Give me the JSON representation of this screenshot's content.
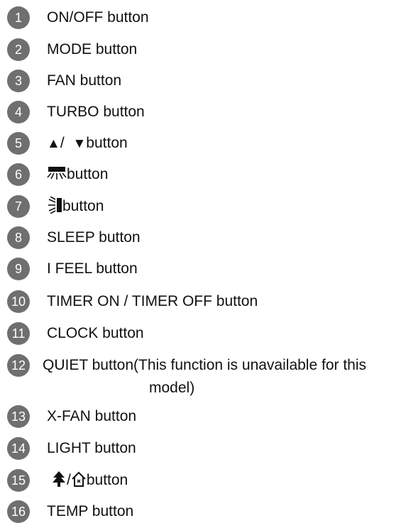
{
  "items": [
    {
      "num": "1",
      "label": "ON/OFF button"
    },
    {
      "num": "2",
      "label": "MODE button"
    },
    {
      "num": "3",
      "label": "FAN button"
    },
    {
      "num": "4",
      "label": "TURBO button"
    },
    {
      "num": "5",
      "up_glyph": "▲",
      "sep": "/ ",
      "down_glyph": "▼",
      "label": "button"
    },
    {
      "num": "6",
      "icon": "swing-up-down-icon",
      "label": "button"
    },
    {
      "num": "7",
      "icon": "swing-left-right-icon",
      "label": "button"
    },
    {
      "num": "8",
      "label": "SLEEP button"
    },
    {
      "num": "9",
      "label": "I FEEL button"
    },
    {
      "num": "10",
      "label": "TIMER ON / TIMER OFF button"
    },
    {
      "num": "11",
      "label": "CLOCK button"
    },
    {
      "num": "12",
      "label": "QUIET button(This function is unavailable for this",
      "label_cont": "model)"
    },
    {
      "num": "13",
      "label": "X-FAN button"
    },
    {
      "num": "14",
      "label": "LIGHT button"
    },
    {
      "num": "15",
      "icon_a": "tree-icon",
      "sep": "/",
      "icon_b": "home-icon",
      "label": "button"
    },
    {
      "num": "16",
      "label": "TEMP button"
    }
  ],
  "colors": {
    "badge": "#6f6f6f",
    "text": "#111111"
  }
}
